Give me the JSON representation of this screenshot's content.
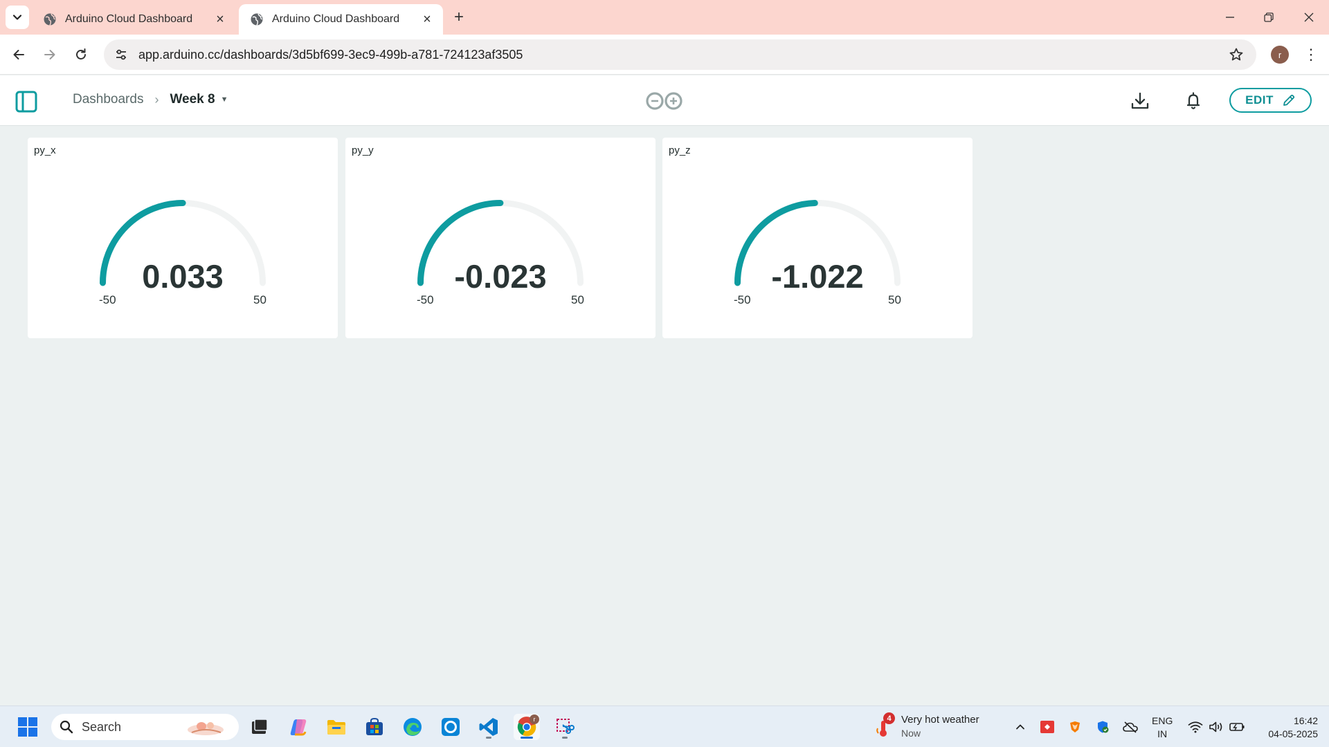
{
  "browser": {
    "tabs": [
      {
        "title": "Arduino Cloud Dashboard",
        "active": false
      },
      {
        "title": "Arduino Cloud Dashboard",
        "active": true
      }
    ],
    "url": "app.arduino.cc/dashboards/3d5bf699-3ec9-499b-a781-724123af3505",
    "profile_initial": "r"
  },
  "header": {
    "breadcrumb_root": "Dashboards",
    "breadcrumb_current": "Week 8",
    "edit_label": "EDIT"
  },
  "widgets": [
    {
      "title": "py_x",
      "value": "0.033",
      "min": "-50",
      "max": "50"
    },
    {
      "title": "py_y",
      "value": "-0.023",
      "min": "-50",
      "max": "50"
    },
    {
      "title": "py_z",
      "value": "-1.022",
      "min": "-50",
      "max": "50"
    }
  ],
  "taskbar": {
    "search_placeholder": "Search",
    "weather_title": "Very hot weather",
    "weather_sub": "Now",
    "weather_badge": "4",
    "lang_line1": "ENG",
    "lang_line2": "IN",
    "time": "16:42",
    "date": "04-05-2025",
    "chrome_badge": "r"
  },
  "colors": {
    "accent": "#0e9ca0",
    "tab_strip": "#fcd6cf",
    "page_bg": "#ecf1f1"
  }
}
